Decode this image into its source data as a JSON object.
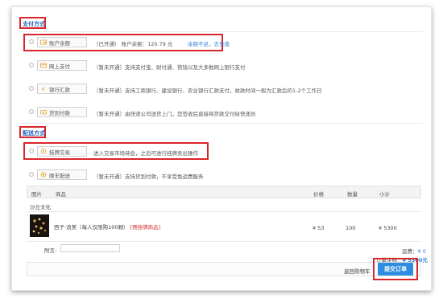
{
  "payment": {
    "title": "支付方式",
    "options": [
      {
        "label": "账户余额",
        "icon": "wallet-icon",
        "desc": "（已开通） 账户余额：120.79 元",
        "link": "余额不足，去充值"
      },
      {
        "label": "网上支付",
        "icon": "card-icon",
        "desc": "（暂未开通）支持支付宝、财付通、快钱以及大多数网上银行支付"
      },
      {
        "label": "银行汇款",
        "icon": "yen-icon",
        "desc": "（暂未开通）支持工商银行、建设银行、农业银行汇款支付，收款时间一般为汇款后的1-2个工作日"
      },
      {
        "label": "货到付款",
        "icon": "cash-icon",
        "desc": "（暂未开通）由快递公司送货上门，您签收后直接将货款交付给快递员"
      }
    ]
  },
  "delivery": {
    "title": "配送方式",
    "options": [
      {
        "label": "挂牌交易",
        "icon": "tag-icon",
        "desc": "进入交易市场待会，之后可进行挂牌卖出操作"
      },
      {
        "label": "顺丰配送",
        "icon": "truck-icon",
        "desc": "（暂未开通）支持货到付款，不享受免运费服务"
      }
    ]
  },
  "table": {
    "headers": [
      "图片",
      "商品",
      "价格",
      "数量",
      "小计"
    ],
    "shop": "沙丘文化",
    "item": {
      "name": "西子·浪美（每人仅限购100颗）",
      "tag": "[预挂牌商品]",
      "price": "¥ 53",
      "qty": "100",
      "subtotal": "¥ 5300"
    }
  },
  "remark_label": "附言:",
  "summary": {
    "shipping_label": "运费：",
    "shipping_value": "¥ 0",
    "total_label": "订单金额：",
    "total_value": "¥ 5300元"
  },
  "actions": {
    "back": "返回购物车",
    "submit": "提交订单"
  }
}
